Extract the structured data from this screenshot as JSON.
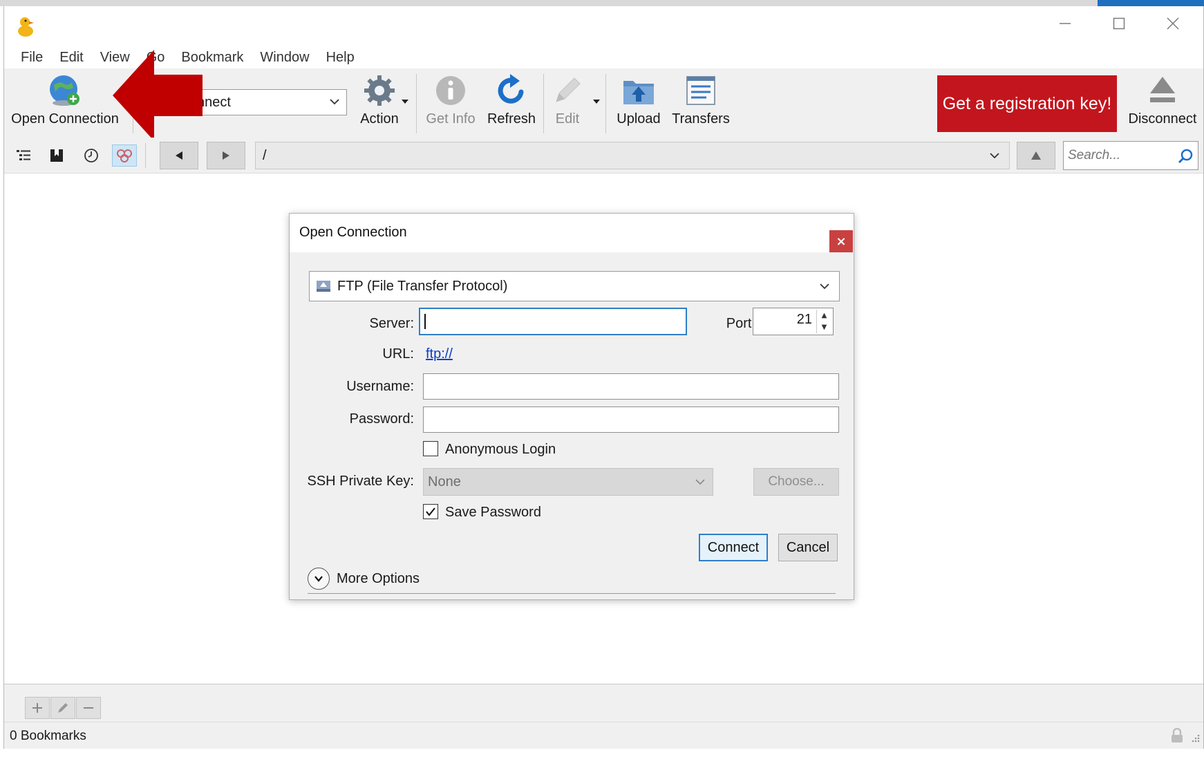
{
  "menu": [
    "File",
    "Edit",
    "View",
    "Go",
    "Bookmark",
    "Window",
    "Help"
  ],
  "toolbar": {
    "open_connection": "Open Connection",
    "quick_connect_value": "nnect",
    "action": "Action",
    "get_info": "Get Info",
    "refresh": "Refresh",
    "edit": "Edit",
    "upload": "Upload",
    "transfers": "Transfers",
    "registration": "Get a registration key!",
    "disconnect": "Disconnect"
  },
  "pathbar": {
    "path": "/",
    "search_placeholder": "Search..."
  },
  "dialog": {
    "title": "Open Connection",
    "close": "×",
    "protocol": "FTP (File Transfer Protocol)",
    "server_label": "Server:",
    "server_value": "",
    "port_label": "Port:",
    "port_value": "21",
    "url_label": "URL:",
    "url_value": "ftp://",
    "username_label": "Username:",
    "username_value": "",
    "password_label": "Password:",
    "password_value": "",
    "anonymous_label": "Anonymous Login",
    "anonymous_checked": false,
    "ssh_label": "SSH Private Key:",
    "ssh_value": "None",
    "choose_label": "Choose...",
    "save_password_label": "Save Password",
    "save_password_checked": true,
    "connect_label": "Connect",
    "cancel_label": "Cancel",
    "more_options_label": "More Options"
  },
  "status": {
    "bookmarks": "0 Bookmarks"
  },
  "colors": {
    "registration_bg": "#c3151d",
    "annotation_arrow": "#c00000",
    "focus_border": "#2f7fc7",
    "link": "#0b3cc9"
  },
  "icons": {
    "app": "duck-icon",
    "open_connection": "globe-plus-icon",
    "action": "gear-icon",
    "get_info": "info-icon",
    "refresh": "refresh-icon",
    "edit": "pencil-icon",
    "upload": "upload-folder-icon",
    "transfers": "transfers-icon",
    "disconnect": "eject-icon"
  }
}
